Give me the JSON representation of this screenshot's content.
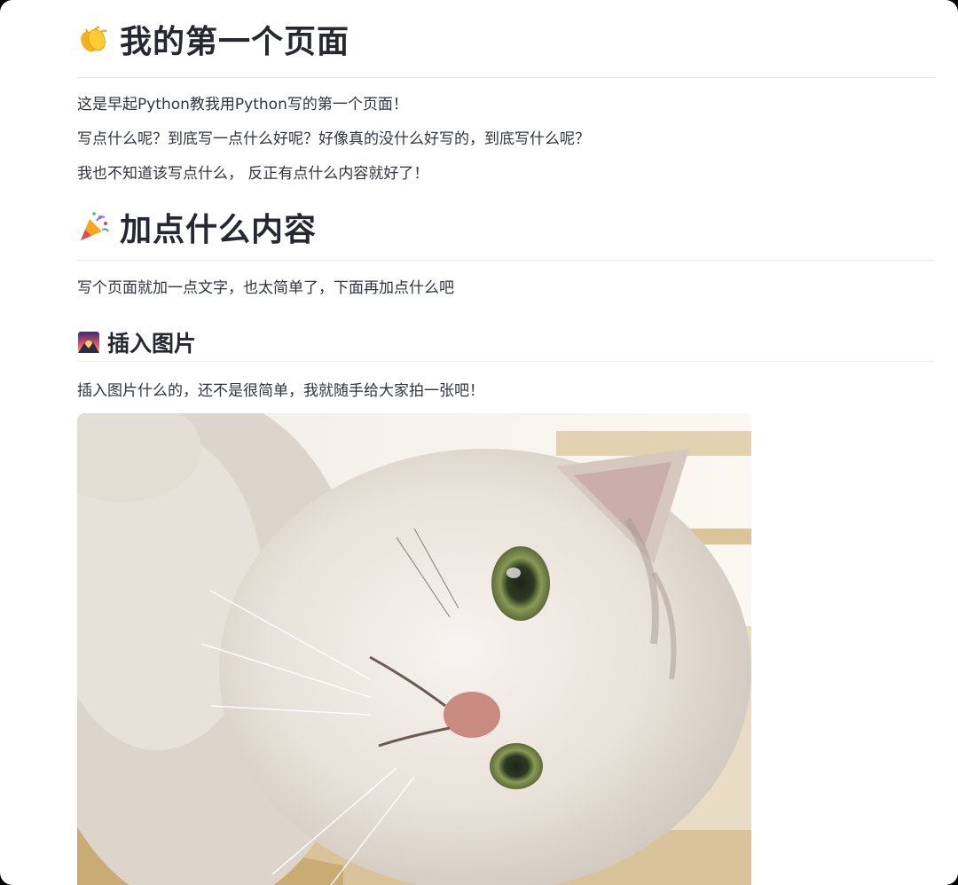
{
  "section1": {
    "icon": "clapping-hands-icon",
    "title": "我的第一个页面",
    "paragraphs": [
      "这是早起Python教我用Python写的第一个页面！",
      "写点什么呢？到底写一点什么好呢？好像真的没什么好写的，到底写什么呢？",
      "我也不知道该写点什么， 反正有点什么内容就好了！"
    ]
  },
  "section2": {
    "icon": "party-popper-icon",
    "title": "加点什么内容",
    "paragraph": "写个页面就加一点文字，也太简单了，下面再加点什么吧"
  },
  "section3": {
    "icon": "sunrise-over-mountains-icon",
    "title": "插入图片",
    "paragraph": "插入图片什么的，还不是很简单，我就随手给大家拍一张吧！",
    "image_icon": "cat-photo"
  }
}
